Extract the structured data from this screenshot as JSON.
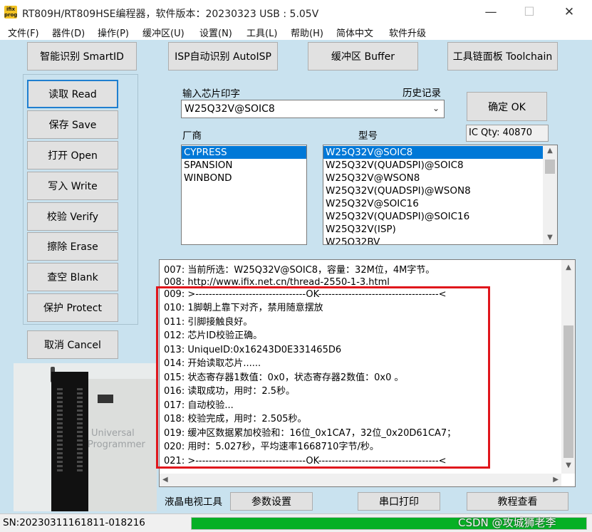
{
  "window": {
    "logo_text": "ifix prog",
    "title": "RT809H/RT809HSE编程器，软件版本：20230323  USB : 5.05V",
    "minimize": "—",
    "maximize": "☐",
    "close": "✕"
  },
  "menu": [
    "文件(F)",
    "器件(D)",
    "操作(P)",
    "缓冲区(U)",
    "设置(N)",
    "工具(L)",
    "帮助(H)",
    "简体中文",
    "软件升级"
  ],
  "top_buttons": {
    "smartid": "智能识别 SmartID",
    "autoisp": "ISP自动识别 AutoISP",
    "buffer": "缓冲区 Buffer",
    "toolchain": "工具链面板 Toolchain"
  },
  "side_buttons": {
    "read": "读取 Read",
    "save": "保存 Save",
    "open": "打开 Open",
    "write": "写入 Write",
    "verify": "校验 Verify",
    "erase": "擦除 Erase",
    "blank": "查空 Blank",
    "protect": "保护 Protect",
    "cancel": "取消 Cancel"
  },
  "chip": {
    "input_label": "输入芯片印字",
    "history_label": "历史记录",
    "selected": "W25Q32V@SOIC8",
    "ok_button": "确定 OK",
    "ic_qty": "IC Qty: 40870",
    "vendor_label": "厂商",
    "model_label": "型号",
    "vendors": [
      "CYPRESS",
      "SPANSION",
      "WINBOND"
    ],
    "models": [
      "W25Q32V@SOIC8",
      "W25Q32V(QUADSPI)@SOIC8",
      "W25Q32V@WSON8",
      "W25Q32V(QUADSPI)@WSON8",
      "W25Q32V@SOIC16",
      "W25Q32V(QUADSPI)@SOIC16",
      "W25Q32V(ISP)",
      "W25Q32BV"
    ]
  },
  "log": [
    "007:  当前所选：W25Q32V@SOIC8，容量：32M位，4M字节。",
    "008:  http://www.ifix.net.cn/thread-2550-1-3.html",
    "009:  >---------------------------------OK------------------------------------<",
    "010:  1脚朝上靠下对齐，禁用随意摆放",
    "011:  引脚接触良好。",
    "012:  芯片ID校验正确。",
    "013:  UniqueID:0x16243D0E331465D6",
    "014:  开始读取芯片......",
    "015:  状态寄存器1数值：0x0，状态寄存器2数值：0x0 。",
    "016:  读取成功，用时：2.5秒。",
    "017:  自动校验...",
    "018:  校验完成，用时：2.505秒。",
    "019:  缓冲区数据累加校验和：16位_0x1CA7，32位_0x20D61CA7；",
    "020:  用时：5.027秒，平均速率1668710字节/秒。",
    "021:  >---------------------------------OK------------------------------------<"
  ],
  "bottom": {
    "lcd_label": "液晶电视工具",
    "params": "参数设置",
    "serial": "串口打印",
    "tutorial": "教程查看"
  },
  "status": {
    "sn": "SN:20230311161811-018216",
    "progress": 1.0,
    "watermark": "CSDN @攻城狮老李"
  },
  "programmer_image": {
    "caption1": "Universal",
    "caption2": "Programmer"
  },
  "colors": {
    "background": "#c9e2ef",
    "selection": "#0078d7",
    "progress": "#06b025",
    "highlight_box": "#e0161c"
  }
}
